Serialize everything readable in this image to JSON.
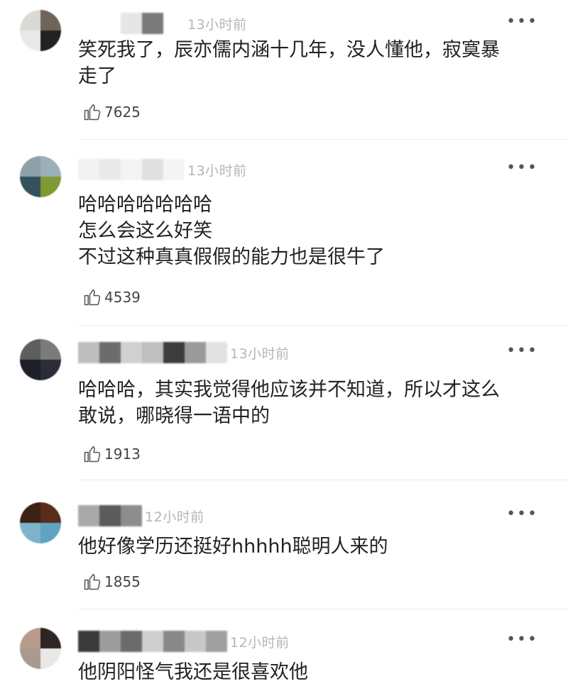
{
  "comments": [
    {
      "time": "13小时前",
      "lines": [
        "笑死我了，辰亦儒内涵十几年，没人懂他，寂寞暴",
        "走了"
      ],
      "likes": "7625",
      "avatar_colors": [
        "#d9d9d6",
        "#6f6457",
        "#e9e9e7",
        "#222222"
      ],
      "mosaic_colors": [
        "#ffffff",
        "#ffffff",
        "#e6e6e6",
        "#7a7a7a",
        "#ffffff"
      ]
    },
    {
      "time": "13小时前",
      "lines": [
        "哈哈哈哈哈哈哈",
        "怎么会这么好笑",
        "不过这种真真假假的能力也是很牛了"
      ],
      "likes": "4539",
      "avatar_colors": [
        "#8ea0aa",
        "#9bb0b8",
        "#34505c",
        "#7e9a33"
      ],
      "mosaic_colors": [
        "#f2f2f2",
        "#e9e9e9",
        "#f4f4f4",
        "#e0e0e0",
        "#f5f5f5"
      ]
    },
    {
      "time": "13小时前",
      "lines": [
        "哈哈哈，其实我觉得他应该并不知道，所以才这么",
        "敢说，哪晓得一语中的"
      ],
      "likes": "1913",
      "avatar_colors": [
        "#5e5e5e",
        "#7b7b7b",
        "#1e2028",
        "#2b2d36"
      ],
      "mosaic_colors": [
        "#bdbdbd",
        "#6c6c6c",
        "#d0d0d0",
        "#bfbfbf",
        "#3c3c3c",
        "#9a9a9a",
        "#e2e2e2"
      ]
    },
    {
      "time": "12小时前",
      "lines": [
        "他好像学历还挺好hhhhh聪明人来的"
      ],
      "likes": "1855",
      "avatar_colors": [
        "#3d1f14",
        "#5a2c1c",
        "#7db4c9",
        "#5ea4c2"
      ],
      "mosaic_colors": [
        "#a9a9a9",
        "#5b5b5b",
        "#8d8d8d"
      ]
    },
    {
      "time": "12小时前",
      "lines": [
        "他阴阳怪气我还是很喜欢他"
      ],
      "likes": "",
      "avatar_colors": [
        "#b79c8c",
        "#2c2522",
        "#a89a90",
        "#e8e8e8"
      ],
      "mosaic_colors": [
        "#3a3a3a",
        "#9c9c9c",
        "#6b6b6b",
        "#cfcfcf",
        "#888888",
        "#c8c8c8",
        "#a0a0a0"
      ]
    }
  ],
  "more_label": "•••"
}
